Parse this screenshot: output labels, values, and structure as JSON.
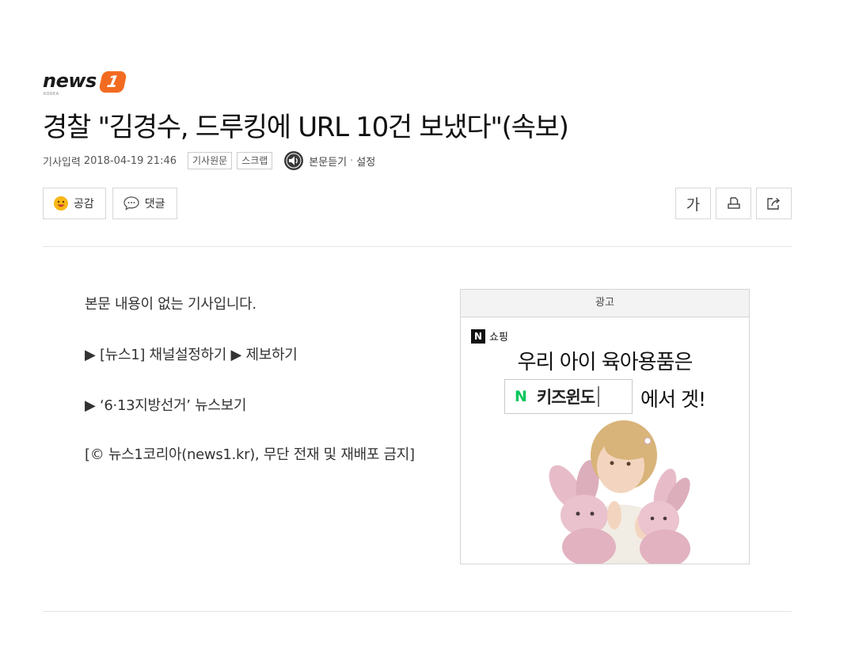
{
  "brand": {
    "logo_word": "news",
    "logo_number": "1",
    "logo_sub": "KOREA",
    "logo_color": "#f26b21"
  },
  "article": {
    "headline": "경찰 \"김경수, 드루킹에 URL 10건 보냈다\"(속보)",
    "meta": {
      "input_label": "기사입력",
      "datetime": "2018-04-19 21:46",
      "tag_original": "기사원문",
      "tag_scrap": "스크랩",
      "listen_label": "본문듣기",
      "separator": "·",
      "setting_label": "설정",
      "listen_icon": "speaker-icon"
    },
    "actions": {
      "like_label": "공감",
      "like_icon": "smile-emoji-icon",
      "comment_label": "댓글",
      "comment_icon": "speech-bubble-icon",
      "font_size_label": "가",
      "print_icon": "print-icon",
      "share_icon": "share-icon"
    },
    "body": {
      "line1": "본문 내용이 없는 기사입니다.",
      "line2": "▶ [뉴스1] 채널설정하기 ▶ 제보하기",
      "line3": "▶ ‘6·13지방선거’ 뉴스보기",
      "line4": "[© 뉴스1코리아(news1.kr), 무단 전재 및 재배포 금지]"
    }
  },
  "ad": {
    "label": "광고",
    "shop_mark": "N",
    "shop_label": "쇼핑",
    "headline": "우리 아이 육아용품은",
    "search_mark": "N",
    "search_keyword": "키즈윈도",
    "suffix": "에서 겟!",
    "image": "child-with-bunny-plush",
    "search_mark_color": "#03c75a"
  }
}
